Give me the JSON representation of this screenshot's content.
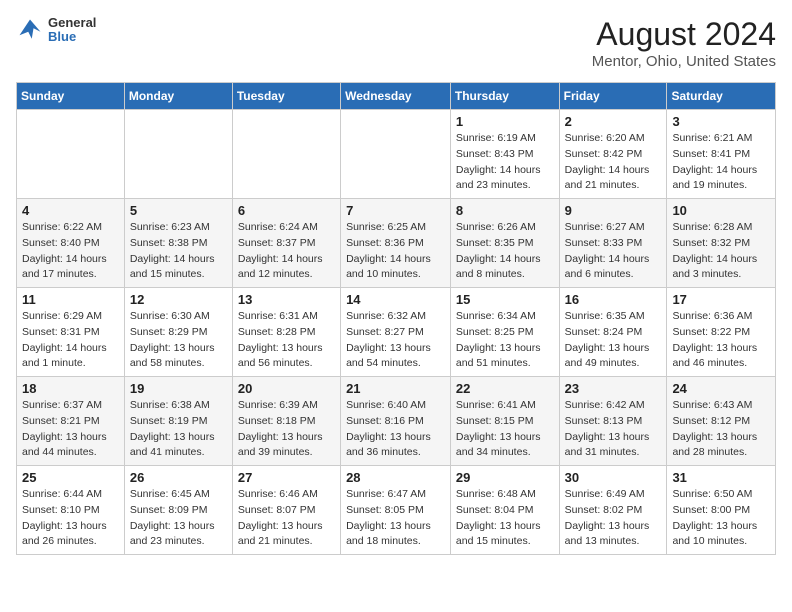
{
  "header": {
    "logo": {
      "general": "General",
      "blue": "Blue"
    },
    "title": "August 2024",
    "location": "Mentor, Ohio, United States"
  },
  "days_of_week": [
    "Sunday",
    "Monday",
    "Tuesday",
    "Wednesday",
    "Thursday",
    "Friday",
    "Saturday"
  ],
  "weeks": [
    [
      {
        "day": "",
        "info": ""
      },
      {
        "day": "",
        "info": ""
      },
      {
        "day": "",
        "info": ""
      },
      {
        "day": "",
        "info": ""
      },
      {
        "day": "1",
        "info": "Sunrise: 6:19 AM\nSunset: 8:43 PM\nDaylight: 14 hours and 23 minutes."
      },
      {
        "day": "2",
        "info": "Sunrise: 6:20 AM\nSunset: 8:42 PM\nDaylight: 14 hours and 21 minutes."
      },
      {
        "day": "3",
        "info": "Sunrise: 6:21 AM\nSunset: 8:41 PM\nDaylight: 14 hours and 19 minutes."
      }
    ],
    [
      {
        "day": "4",
        "info": "Sunrise: 6:22 AM\nSunset: 8:40 PM\nDaylight: 14 hours and 17 minutes."
      },
      {
        "day": "5",
        "info": "Sunrise: 6:23 AM\nSunset: 8:38 PM\nDaylight: 14 hours and 15 minutes."
      },
      {
        "day": "6",
        "info": "Sunrise: 6:24 AM\nSunset: 8:37 PM\nDaylight: 14 hours and 12 minutes."
      },
      {
        "day": "7",
        "info": "Sunrise: 6:25 AM\nSunset: 8:36 PM\nDaylight: 14 hours and 10 minutes."
      },
      {
        "day": "8",
        "info": "Sunrise: 6:26 AM\nSunset: 8:35 PM\nDaylight: 14 hours and 8 minutes."
      },
      {
        "day": "9",
        "info": "Sunrise: 6:27 AM\nSunset: 8:33 PM\nDaylight: 14 hours and 6 minutes."
      },
      {
        "day": "10",
        "info": "Sunrise: 6:28 AM\nSunset: 8:32 PM\nDaylight: 14 hours and 3 minutes."
      }
    ],
    [
      {
        "day": "11",
        "info": "Sunrise: 6:29 AM\nSunset: 8:31 PM\nDaylight: 14 hours and 1 minute."
      },
      {
        "day": "12",
        "info": "Sunrise: 6:30 AM\nSunset: 8:29 PM\nDaylight: 13 hours and 58 minutes."
      },
      {
        "day": "13",
        "info": "Sunrise: 6:31 AM\nSunset: 8:28 PM\nDaylight: 13 hours and 56 minutes."
      },
      {
        "day": "14",
        "info": "Sunrise: 6:32 AM\nSunset: 8:27 PM\nDaylight: 13 hours and 54 minutes."
      },
      {
        "day": "15",
        "info": "Sunrise: 6:34 AM\nSunset: 8:25 PM\nDaylight: 13 hours and 51 minutes."
      },
      {
        "day": "16",
        "info": "Sunrise: 6:35 AM\nSunset: 8:24 PM\nDaylight: 13 hours and 49 minutes."
      },
      {
        "day": "17",
        "info": "Sunrise: 6:36 AM\nSunset: 8:22 PM\nDaylight: 13 hours and 46 minutes."
      }
    ],
    [
      {
        "day": "18",
        "info": "Sunrise: 6:37 AM\nSunset: 8:21 PM\nDaylight: 13 hours and 44 minutes."
      },
      {
        "day": "19",
        "info": "Sunrise: 6:38 AM\nSunset: 8:19 PM\nDaylight: 13 hours and 41 minutes."
      },
      {
        "day": "20",
        "info": "Sunrise: 6:39 AM\nSunset: 8:18 PM\nDaylight: 13 hours and 39 minutes."
      },
      {
        "day": "21",
        "info": "Sunrise: 6:40 AM\nSunset: 8:16 PM\nDaylight: 13 hours and 36 minutes."
      },
      {
        "day": "22",
        "info": "Sunrise: 6:41 AM\nSunset: 8:15 PM\nDaylight: 13 hours and 34 minutes."
      },
      {
        "day": "23",
        "info": "Sunrise: 6:42 AM\nSunset: 8:13 PM\nDaylight: 13 hours and 31 minutes."
      },
      {
        "day": "24",
        "info": "Sunrise: 6:43 AM\nSunset: 8:12 PM\nDaylight: 13 hours and 28 minutes."
      }
    ],
    [
      {
        "day": "25",
        "info": "Sunrise: 6:44 AM\nSunset: 8:10 PM\nDaylight: 13 hours and 26 minutes."
      },
      {
        "day": "26",
        "info": "Sunrise: 6:45 AM\nSunset: 8:09 PM\nDaylight: 13 hours and 23 minutes."
      },
      {
        "day": "27",
        "info": "Sunrise: 6:46 AM\nSunset: 8:07 PM\nDaylight: 13 hours and 21 minutes."
      },
      {
        "day": "28",
        "info": "Sunrise: 6:47 AM\nSunset: 8:05 PM\nDaylight: 13 hours and 18 minutes."
      },
      {
        "day": "29",
        "info": "Sunrise: 6:48 AM\nSunset: 8:04 PM\nDaylight: 13 hours and 15 minutes."
      },
      {
        "day": "30",
        "info": "Sunrise: 6:49 AM\nSunset: 8:02 PM\nDaylight: 13 hours and 13 minutes."
      },
      {
        "day": "31",
        "info": "Sunrise: 6:50 AM\nSunset: 8:00 PM\nDaylight: 13 hours and 10 minutes."
      }
    ]
  ]
}
